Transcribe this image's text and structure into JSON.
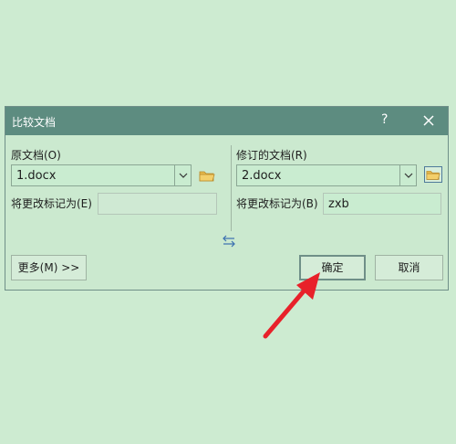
{
  "dialog": {
    "title": "比较文档",
    "help": "?",
    "original": {
      "label": "原文档(O)",
      "value": "1.docx",
      "mark_label": "将更改标记为(E)",
      "mark_value": ""
    },
    "revised": {
      "label": "修订的文档(R)",
      "value": "2.docx",
      "mark_label": "将更改标记为(B)",
      "mark_value": "zxb"
    },
    "more_button": "更多(M) >>",
    "ok_button": "确定",
    "cancel_button": "取消"
  },
  "colors": {
    "titlebar": "#5d8c80",
    "background": "#cdebd1",
    "arrow": "#e8212a"
  },
  "icons": [
    "close-icon",
    "chevron-down-icon",
    "folder-icon",
    "swap-icon"
  ]
}
